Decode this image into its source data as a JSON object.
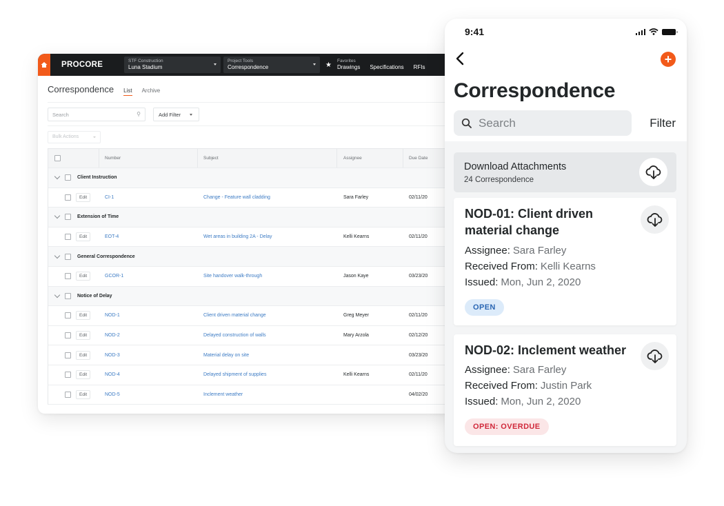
{
  "desktop": {
    "brand": "PROCORE",
    "company_selector": {
      "label": "STF Construction",
      "value": "Luna Stadium"
    },
    "tool_selector": {
      "label": "Project Tools",
      "value": "Correspondence"
    },
    "favorites": {
      "label": "Favorites",
      "links": [
        "Drawings",
        "Specifications",
        "RFIs"
      ]
    },
    "page_title": "Correspondence",
    "tabs": [
      {
        "label": "List",
        "active": true
      },
      {
        "label": "Archive",
        "active": false
      }
    ],
    "search_placeholder": "Search",
    "add_filter_label": "Add Filter",
    "bulk_actions_label": "Bulk Actions",
    "table": {
      "columns": [
        "Number",
        "Subject",
        "Assignee",
        "Due Date"
      ],
      "edit_label": "Edit",
      "groups": [
        {
          "name": "Client Instruction",
          "rows": [
            {
              "number": "CI-1",
              "subject": "Change - Feature wall cladding",
              "assignee": "Sara Farley",
              "due": "02/11/20"
            }
          ]
        },
        {
          "name": "Extension of Time",
          "rows": [
            {
              "number": "EOT-4",
              "subject": "Wet areas in building 2A - Delay",
              "assignee": "Kelli Kearns",
              "due": "02/11/20"
            }
          ]
        },
        {
          "name": "General Correspondence",
          "rows": [
            {
              "number": "GCOR-1",
              "subject": "Site handover walk-through",
              "assignee": "Jason Kaye",
              "due": "03/23/20"
            }
          ]
        },
        {
          "name": "Notice of Delay",
          "rows": [
            {
              "number": "NOD-1",
              "subject": "Client driven material change",
              "assignee": "Greg Meyer",
              "due": "02/11/20"
            },
            {
              "number": "NOD-2",
              "subject": "Delayed construction of walls",
              "assignee": "Mary Arzola",
              "due": "02/12/20"
            },
            {
              "number": "NOD-3",
              "subject": "Material delay on site",
              "assignee": "",
              "due": "03/23/20"
            },
            {
              "number": "NOD-4",
              "subject": "Delayed shipment of supplies",
              "assignee": "Kelli Kearns",
              "due": "02/11/20"
            },
            {
              "number": "NOD-5",
              "subject": "Inclement weather",
              "assignee": "",
              "due": "04/02/20"
            }
          ]
        }
      ]
    }
  },
  "mobile": {
    "time": "9:41",
    "title": "Correspondence",
    "search_placeholder": "Search",
    "filter_label": "Filter",
    "download": {
      "title": "Download Attachments",
      "subtitle": "24 Correspondence"
    },
    "labels": {
      "assignee": "Assignee:",
      "received_from": "Received From:",
      "issued": "Issued:"
    },
    "cards": [
      {
        "title": "NOD-01: Client driven material change",
        "assignee": "Sara Farley",
        "received_from": "Kelli Kearns",
        "issued": "Mon, Jun 2, 2020",
        "status": "OPEN",
        "status_type": "open"
      },
      {
        "title": "NOD-02: Inclement weather",
        "assignee": "Sara Farley",
        "received_from": "Justin Park",
        "issued": "Mon, Jun 2, 2020",
        "status": "OPEN: OVERDUE",
        "status_type": "overdue"
      }
    ]
  },
  "colors": {
    "brand_orange": "#f25a1a",
    "link_blue": "#3c7bc4",
    "topbar": "#1a1c1e",
    "open_badge": "#dcebfa",
    "overdue_badge": "#fbe6e7"
  }
}
